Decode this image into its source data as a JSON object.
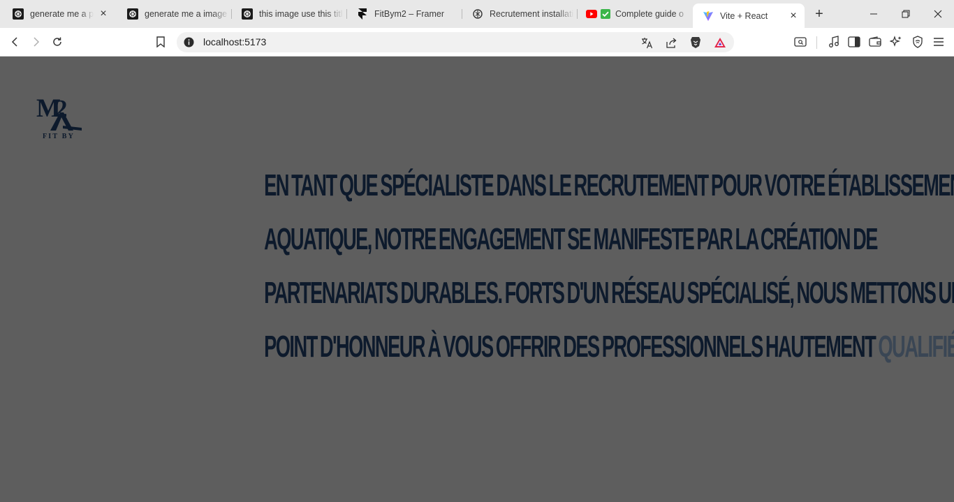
{
  "browser": {
    "tabs": [
      {
        "label": "generate me a pr",
        "favicon": "openai-icon",
        "active": false
      },
      {
        "label": "generate me a image",
        "favicon": "openai-icon",
        "active": false
      },
      {
        "label": "this image use this titl",
        "favicon": "openai-icon",
        "active": false
      },
      {
        "label": "FitBym2 – Framer",
        "favicon": "framer-icon",
        "active": false
      },
      {
        "label": "Recrutement installati",
        "favicon": "openai-outline-icon",
        "active": false
      },
      {
        "label": "Complete guide o",
        "favicon": "youtube-icon",
        "active": false
      },
      {
        "label": "Vite + React",
        "favicon": "vite-icon",
        "active": true
      }
    ],
    "address": "localhost:5173"
  },
  "site": {
    "logo": {
      "monogram": "M2A",
      "tagline": "FIT BY"
    },
    "hero": {
      "lines": [
        "EN TANT QUE SPÉCIALISTE DANS LE RECRUTEMENT POUR VOTRE ÉTABLISSEMENT",
        "AQUATIQUE, NOTRE ENGAGEMENT SE MANIFESTE PAR LA CRÉATION DE",
        "PARTENARIATS DURABLES. FORTS D'UN RÉSEAU SPÉCIALISÉ, NOUS METTONS UN",
        "POINT D'HONNEUR À VOUS OFFRIR DES PROFESSIONNELS HAUTEMENT"
      ],
      "highlight": "QUALIFIÉS"
    },
    "colors": {
      "background": "#5e5e5e",
      "text": "#0d1a2c",
      "muted": "#3a4654"
    }
  }
}
